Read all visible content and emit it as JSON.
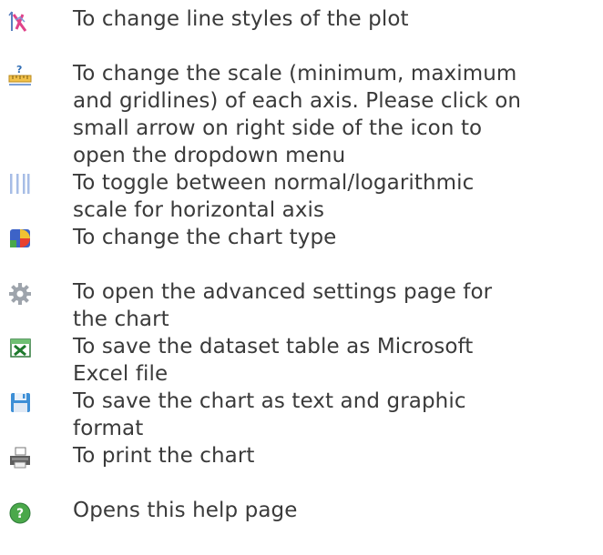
{
  "help_items": [
    {
      "icon": "line-style-icon",
      "text": "To change line styles of the plot"
    },
    {
      "icon": "axis-scale-icon",
      "text": "To change the scale (minimum, maximum\nand gridlines) of each axis. Please click on\nsmall arrow on right side of the icon to\nopen the dropdown menu"
    },
    {
      "icon": "log-scale-icon",
      "text": "To toggle between normal/logarithmic\nscale for horizontal axis"
    },
    {
      "icon": "chart-type-icon",
      "text": "To change the chart type"
    },
    {
      "icon": "settings-gear-icon",
      "text": "To open the advanced settings page for\nthe chart"
    },
    {
      "icon": "excel-icon",
      "text": "To save the dataset table as Microsoft\nExcel file"
    },
    {
      "icon": "save-disk-icon",
      "text": "To save the chart as text and graphic\nformat"
    },
    {
      "icon": "print-icon",
      "text": "To print the chart"
    },
    {
      "icon": "help-icon",
      "text": "Opens this help page"
    }
  ]
}
